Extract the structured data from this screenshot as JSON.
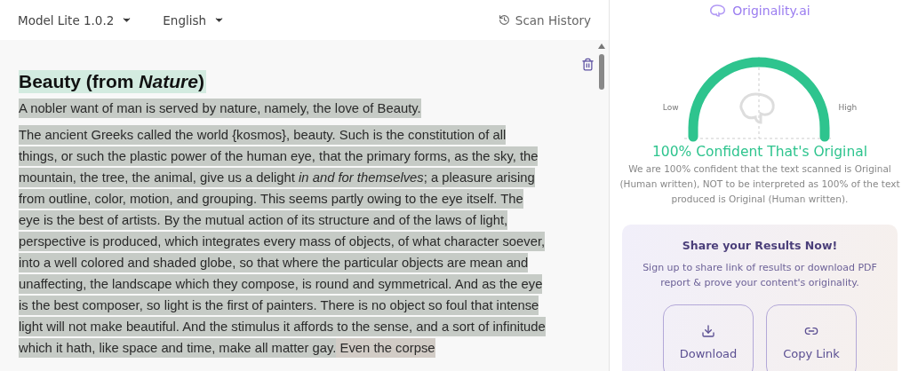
{
  "toolbar": {
    "model": "Model Lite 1.0.2",
    "language": "English",
    "history": "Scan History"
  },
  "document": {
    "title": "Beauty (from *Nature*)",
    "paragraphs": [
      {
        "segments": [
          {
            "text": "A nobler want of man is served by nature, namely, the love of Beauty.",
            "color": "#c6cbc6"
          }
        ]
      },
      {
        "segments": [
          {
            "text": "The ancient Greeks called the world {kosmos}, beauty. Such is the constitution of all things, or such the plastic power of the human eye, that the primary forms, as the sky, the mountain, the tree, the animal, give us a delight *in and for themselves*; a pleasure arising from outline, color, motion, and grouping. This seems partly owing to the eye itself. The eye is the best of artists. By the mutual action of its structure and of the laws of light, perspective is produced, which integrates every mass of objects, of what character soever, into a well colored and shaded globe, so that where the particular objects are mean and unaffecting, the landscape which they compose, is round and symmetrical. And as the eye is the best composer, so light is the first of painters. There is no object so foul that intense light will not make beautiful. And the stimulus it affords to the sense, and a sort of infinitude which it hath, like space and time, make all matter gay.",
            "color": "#c6cbc6"
          },
          {
            "text": " Even the corpse",
            "color": "#d2ccc6"
          }
        ]
      }
    ]
  },
  "result": {
    "brand": "Originality.ai",
    "low": "Low",
    "high": "High",
    "headline": "100% Confident That's Original",
    "note": "We are 100% confident that the text scanned is Original (Human written), NOT to be interpreted as 100% of the text produced is Original (Human written)."
  },
  "share": {
    "title": "Share your Results Now!",
    "text": "Sign up to share link of results or download PDF report & prove your content's originality.",
    "buttons": [
      {
        "kind": "download",
        "label": "Download"
      },
      {
        "kind": "link",
        "label": "Copy Link"
      }
    ]
  }
}
